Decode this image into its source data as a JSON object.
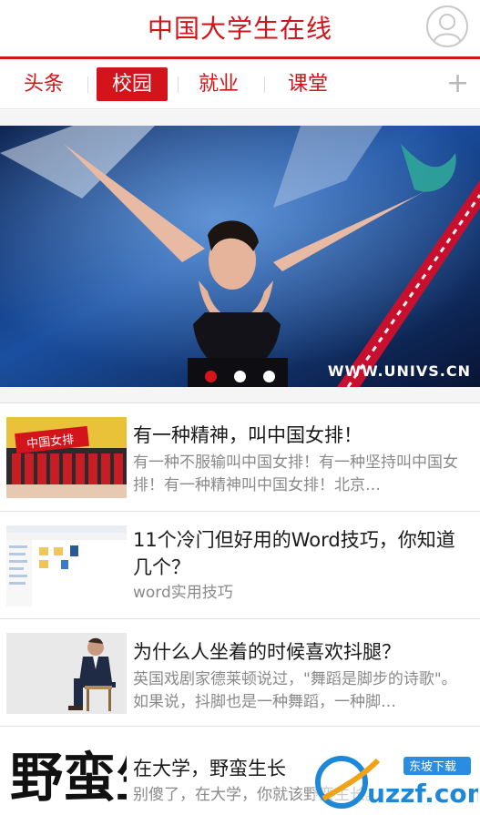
{
  "header": {
    "title": "中国大学生在线",
    "avatar_icon": "user-avatar-icon"
  },
  "tabs": [
    {
      "label": "头条",
      "active": false
    },
    {
      "label": "校园",
      "active": true
    },
    {
      "label": "就业",
      "active": false
    },
    {
      "label": "课堂",
      "active": false
    }
  ],
  "tab_add": "+",
  "banner": {
    "source_text": "WWW.UNIVS.CN",
    "dots_total": 3,
    "active_dot": 0
  },
  "news": [
    {
      "title": "有一种精神，叫中国女排！",
      "summary": "有一种不服输叫中国女排！有一种坚持叫中国女排！有一种精神叫中国女排！北京…",
      "thumb_text": "中国女排"
    },
    {
      "title": "11个冷门但好用的Word技巧，你知道几个？",
      "summary": "word实用技巧"
    },
    {
      "title": "为什么人坐着的时候喜欢抖腿？",
      "summary": "英国戏剧家德莱顿说过，\"舞蹈是脚步的诗歌\"。如果说，抖脚也是一种舞蹈，一种脚…"
    },
    {
      "title": "在大学，野蛮生长",
      "summary": "别傻了，在大学，你就该野蛮生长。",
      "thumb_text": "野蛮生长"
    }
  ],
  "watermark": {
    "brand": "uzzf.com",
    "tag": "东坡下载"
  },
  "colors": {
    "accent": "#d3141b"
  }
}
